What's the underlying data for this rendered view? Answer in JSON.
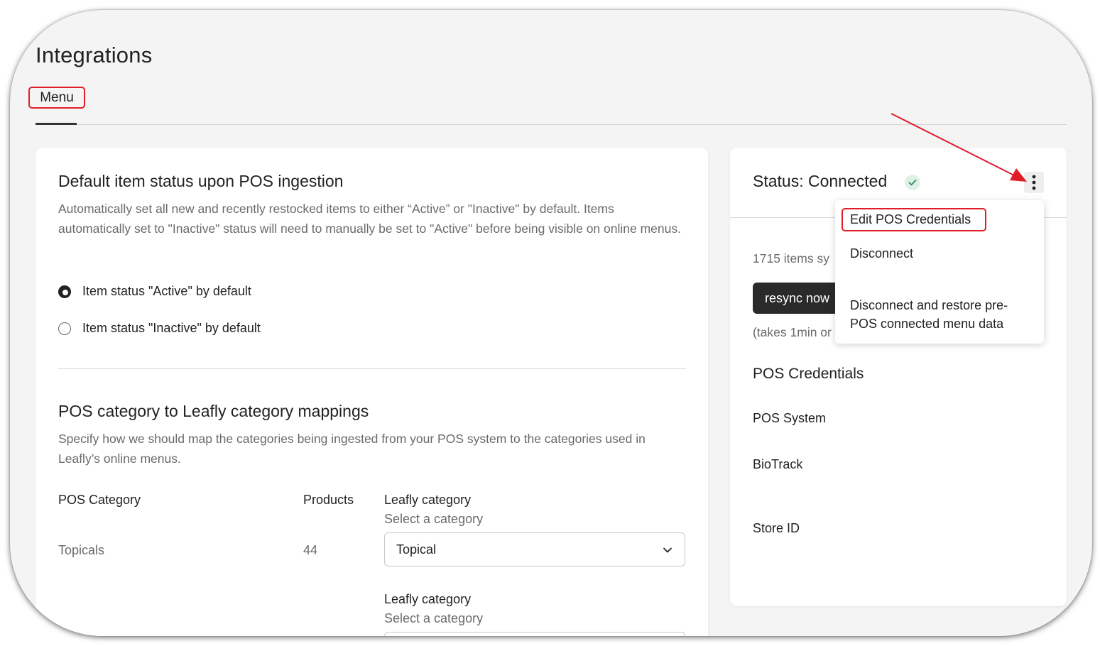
{
  "page": {
    "title": "Integrations"
  },
  "tabs": [
    {
      "label": "Menu"
    }
  ],
  "default_status": {
    "heading": "Default item status upon POS ingestion",
    "description": "Automatically set all new and recently restocked items to either “Active” or \"Inactive\" by default. Items automatically set to \"Inactive\" status will need to manually be set to \"Active\" before being visible on online menus.",
    "options": [
      {
        "label": "Item status \"Active\" by default",
        "selected": true
      },
      {
        "label": "Item status \"Inactive\" by default",
        "selected": false
      }
    ]
  },
  "mappings": {
    "heading": "POS category to Leafly category mappings",
    "description": "Specify how we should map the categories being ingested from your POS system to the categories used in Leafly’s online menus.",
    "columns": {
      "pos_category": "POS Category",
      "products": "Products",
      "leafly_category": "Leafly category"
    },
    "select_hint": "Select a category",
    "rows": [
      {
        "pos_category": "Topicals",
        "products": "44",
        "leafly_category": "Topical"
      }
    ],
    "next_row": {
      "leafly_category_label": "Leafly category",
      "select_hint": "Select a category"
    }
  },
  "status_panel": {
    "title": "Status: Connected",
    "items_synced": "1715 items sy",
    "resync_label": "resync now",
    "takes_note": "(takes 1min or",
    "credentials_title": "POS Credentials",
    "pos_system_label": "POS System",
    "pos_system_value": "BioTrack",
    "store_id_label": "Store ID"
  },
  "actions_menu": {
    "items": [
      {
        "label": "Edit POS Credentials"
      },
      {
        "label": "Disconnect"
      },
      {
        "label": "Disconnect and restore pre-POS connected menu data"
      }
    ]
  },
  "icons": {
    "status": "check-icon",
    "more": "more-vertical-icon",
    "dropdown": "chevron-down-icon"
  },
  "colors": {
    "highlight": "#e11d2a",
    "success": "#2e8b57",
    "primary_button": "#2a2a2a"
  }
}
